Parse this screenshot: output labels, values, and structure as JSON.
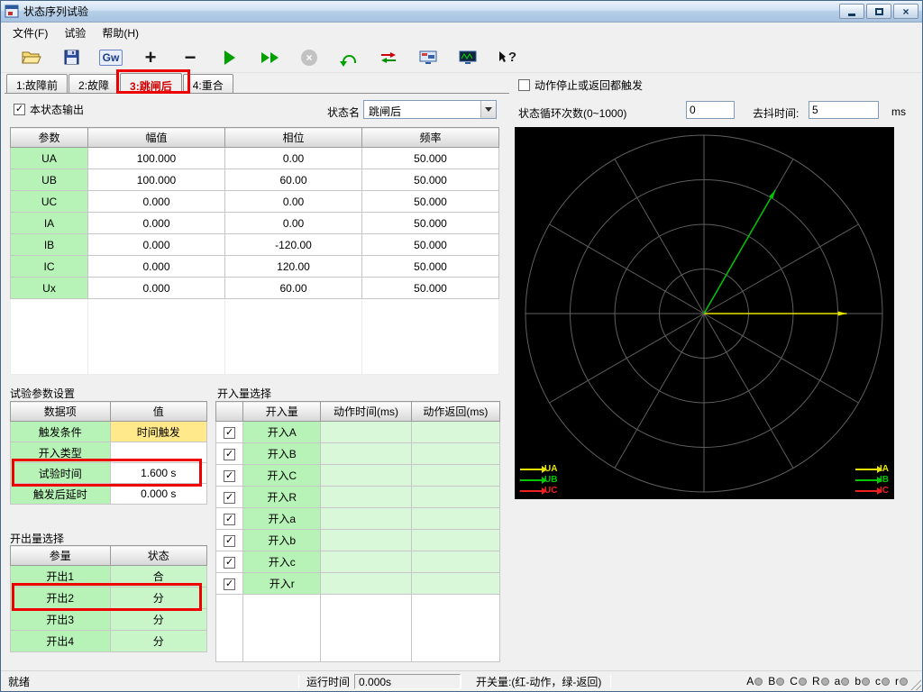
{
  "window": {
    "title": "状态序列试验"
  },
  "menu": {
    "items": [
      {
        "label": "文件(F)"
      },
      {
        "label": "试验"
      },
      {
        "label": "帮助(H)"
      }
    ]
  },
  "toolbar": {
    "glyphs": {
      "gw": "Gw",
      "plus": "+",
      "minus": "−",
      "stop": "×",
      "help": "?"
    }
  },
  "tabs": [
    {
      "label": "1:故障前",
      "active": false
    },
    {
      "label": "2:故障",
      "active": false
    },
    {
      "label": "3:跳闸后",
      "active": true
    },
    {
      "label": "4:重合",
      "active": false
    }
  ],
  "state": {
    "output_checkbox_label": "本状态输出",
    "state_name_label": "状态名",
    "state_name_value": "跳闸后",
    "trigger_checkbox_label": "动作停止或返回都触发",
    "loop_label": "状态循环次数(0~1000)",
    "loop_value": "0",
    "debounce_label": "去抖时间:",
    "debounce_value": "5",
    "debounce_unit": "ms"
  },
  "param_table": {
    "headers": [
      "参数",
      "幅值",
      "相位",
      "频率"
    ],
    "rows": [
      {
        "name": "UA",
        "amp": "100.000",
        "phase": "0.00",
        "freq": "50.000"
      },
      {
        "name": "UB",
        "amp": "100.000",
        "phase": "60.00",
        "freq": "50.000"
      },
      {
        "name": "UC",
        "amp": "0.000",
        "phase": "0.00",
        "freq": "50.000"
      },
      {
        "name": "IA",
        "amp": "0.000",
        "phase": "0.00",
        "freq": "50.000"
      },
      {
        "name": "IB",
        "amp": "0.000",
        "phase": "-120.00",
        "freq": "50.000"
      },
      {
        "name": "IC",
        "amp": "0.000",
        "phase": "120.00",
        "freq": "50.000"
      },
      {
        "name": "Ux",
        "amp": "0.000",
        "phase": "60.00",
        "freq": "50.000"
      }
    ]
  },
  "test_params": {
    "title": "试验参数设置",
    "headers": [
      "数据项",
      "值"
    ],
    "rows": [
      {
        "item": "触发条件",
        "value": "时间触发",
        "highlight": true
      },
      {
        "item": "开入类型",
        "value": "",
        "highlight": false
      },
      {
        "item": "试验时间",
        "value": "1.600 s",
        "highlight": false
      },
      {
        "item": "触发后延时",
        "value": "0.000 s",
        "highlight": false
      }
    ]
  },
  "output_select": {
    "title": "开出量选择",
    "headers": [
      "参量",
      "状态"
    ],
    "rows": [
      {
        "name": "开出1",
        "state": "合"
      },
      {
        "name": "开出2",
        "state": "分"
      },
      {
        "name": "开出3",
        "state": "分"
      },
      {
        "name": "开出4",
        "state": "分"
      }
    ]
  },
  "input_select": {
    "title": "开入量选择",
    "headers": [
      "",
      "开入量",
      "动作时间(ms)",
      "动作返回(ms)"
    ],
    "rows": [
      {
        "name": "开入A",
        "checked": true
      },
      {
        "name": "开入B",
        "checked": true
      },
      {
        "name": "开入C",
        "checked": true
      },
      {
        "name": "开入R",
        "checked": true
      },
      {
        "name": "开入a",
        "checked": true
      },
      {
        "name": "开入b",
        "checked": true
      },
      {
        "name": "开入c",
        "checked": true
      },
      {
        "name": "开入r",
        "checked": true
      }
    ]
  },
  "vector_plot": {
    "vectors": [
      {
        "name": "UA",
        "angle": 0,
        "mag": 0.8,
        "color": "#e6e600"
      },
      {
        "name": "UB",
        "angle": 60,
        "mag": 0.8,
        "color": "#00c800"
      }
    ],
    "legend_left": [
      {
        "label": "UA",
        "color": "#e6e600"
      },
      {
        "label": "UB",
        "color": "#00c800"
      },
      {
        "label": "UC",
        "color": "#f02020"
      }
    ],
    "legend_right": [
      {
        "label": "IA",
        "color": "#e6e600"
      },
      {
        "label": "IB",
        "color": "#00c800"
      },
      {
        "label": "IC",
        "color": "#f02020"
      }
    ]
  },
  "status_bar": {
    "ready": "就绪",
    "runtime_label": "运行时间",
    "runtime_value": "0.000s",
    "switch_label": "开关量:(红-动作，绿-返回)",
    "indicators": [
      {
        "label": "A"
      },
      {
        "label": "B"
      },
      {
        "label": "C"
      },
      {
        "label": "R"
      },
      {
        "label": "a"
      },
      {
        "label": "b"
      },
      {
        "label": "c"
      },
      {
        "label": "r"
      }
    ]
  }
}
